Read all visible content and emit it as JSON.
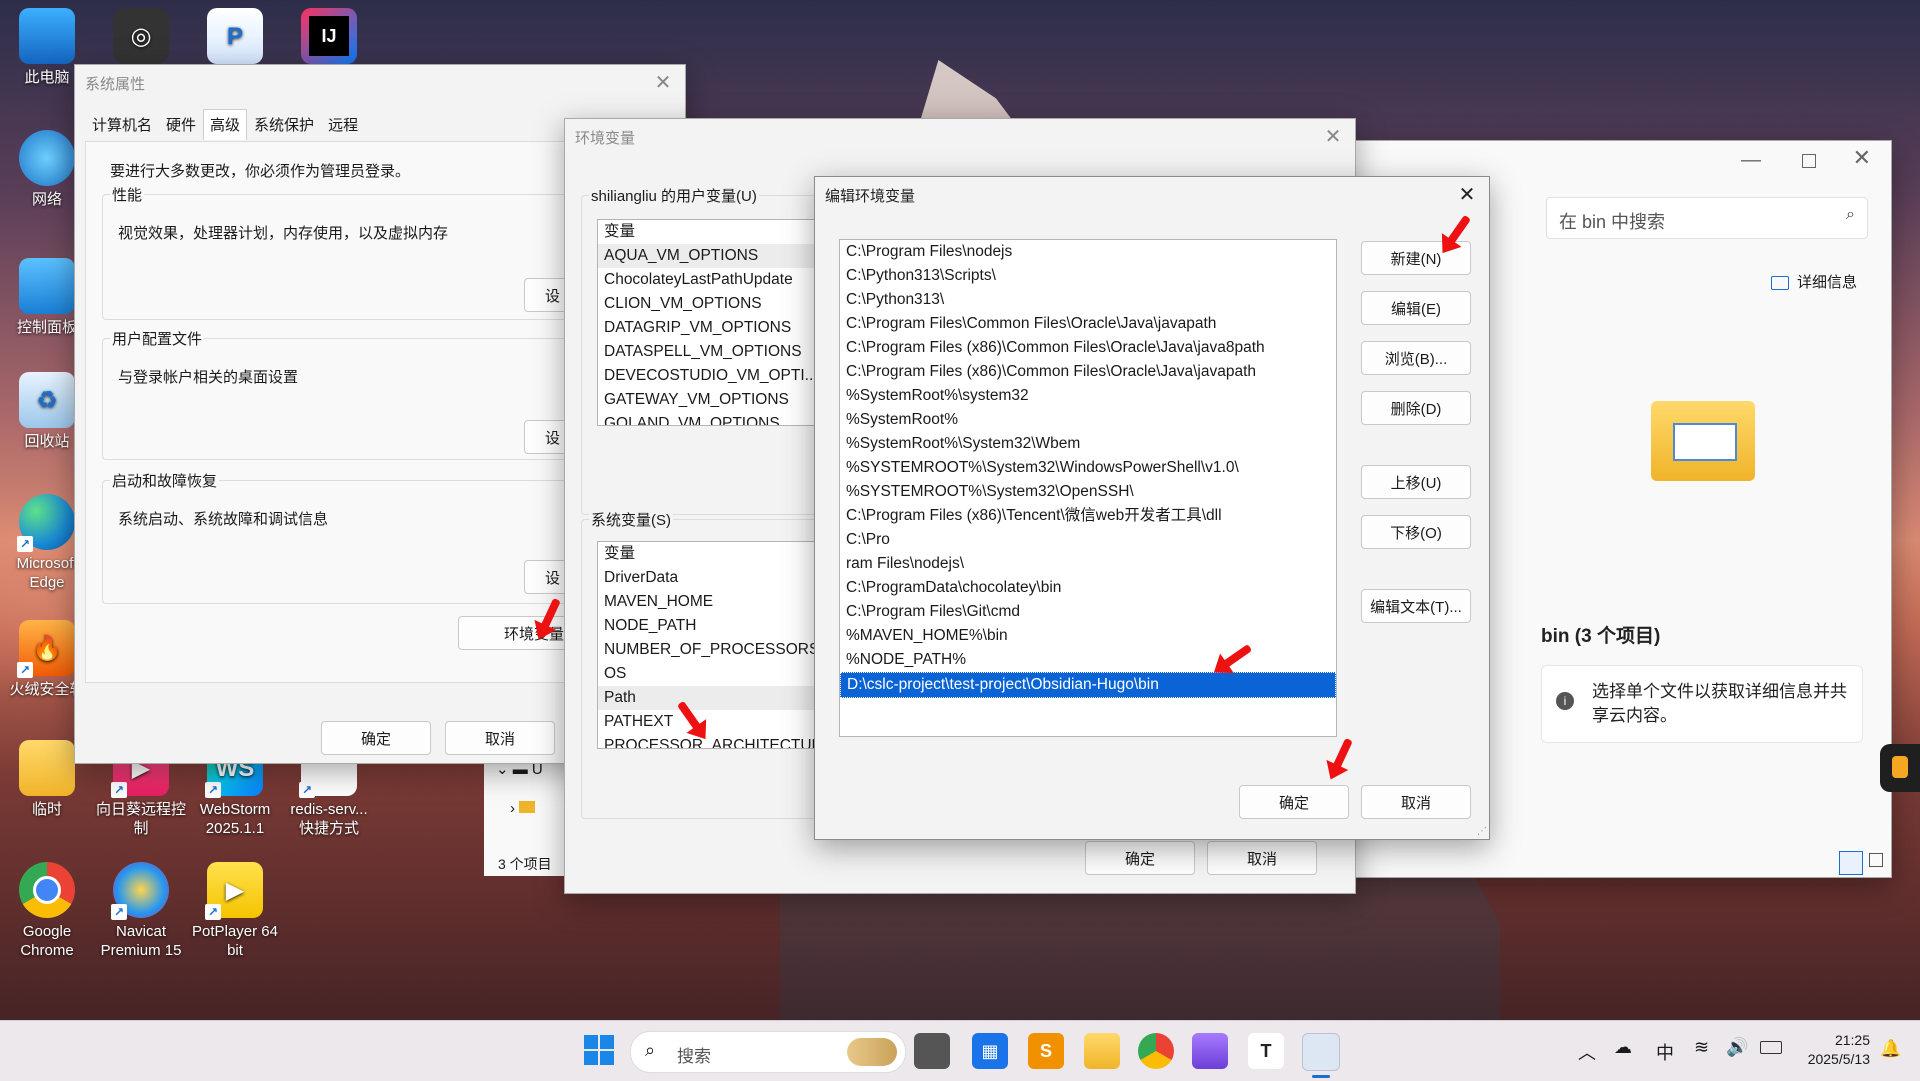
{
  "desktop": {
    "icons": [
      {
        "label": "此电脑"
      },
      {
        "label": "网络"
      },
      {
        "label": "控制面板"
      },
      {
        "label": "回收站"
      },
      {
        "label": "Microsoft Edge"
      },
      {
        "label": "火绒安全软"
      },
      {
        "label": "临时"
      },
      {
        "label": "向日葵远程控制"
      },
      {
        "label": "WebStorm 2025.1.1"
      },
      {
        "label": "redis-serv... 快捷方式"
      },
      {
        "label": "Google Chrome"
      },
      {
        "label": "Navicat Premium 15"
      },
      {
        "label": "PotPlayer 64 bit"
      }
    ]
  },
  "sysprops": {
    "title": "系统属性",
    "tabs": [
      "计算机名",
      "硬件",
      "高级",
      "系统保护",
      "远程"
    ],
    "notice": "要进行大多数更改，你必须作为管理员登录。",
    "perf_label": "性能",
    "perf_desc": "视觉效果，处理器计划，内存使用，以及虚拟内存",
    "profile_label": "用户配置文件",
    "profile_desc": "与登录帐户相关的桌面设置",
    "startup_label": "启动和故障恢复",
    "startup_desc": "系统启动、系统故障和调试信息",
    "settings_btn": "设",
    "env_btn": "环境变量",
    "ok": "确定",
    "cancel": "取消"
  },
  "envvars": {
    "title": "环境变量",
    "user_label": "shiliangliu 的用户变量(U)",
    "user_header": "变量",
    "user_vars": [
      "AQUA_VM_OPTIONS",
      "ChocolateyLastPathUpdate",
      "CLION_VM_OPTIONS",
      "DATAGRIP_VM_OPTIONS",
      "DATASPELL_VM_OPTIONS",
      "DEVECOSTUDIO_VM_OPTI...",
      "GATEWAY_VM_OPTIONS",
      "GOLAND_VM_OPTIONS"
    ],
    "sys_label": "系统变量(S)",
    "sys_header": "变量",
    "sys_vars": [
      "DriverData",
      "MAVEN_HOME",
      "NODE_PATH",
      "NUMBER_OF_PROCESSORS",
      "OS",
      "Path",
      "PATHEXT",
      "PROCESSOR_ARCHITECTURE"
    ],
    "ok": "确定",
    "cancel": "取消"
  },
  "editenv": {
    "title": "编辑环境变量",
    "paths": [
      "C:\\Program Files\\nodejs",
      "C:\\Python313\\Scripts\\",
      "C:\\Python313\\",
      "C:\\Program Files\\Common Files\\Oracle\\Java\\javapath",
      "C:\\Program Files (x86)\\Common Files\\Oracle\\Java\\java8path",
      "C:\\Program Files (x86)\\Common Files\\Oracle\\Java\\javapath",
      "%SystemRoot%\\system32",
      "%SystemRoot%",
      "%SystemRoot%\\System32\\Wbem",
      "%SYSTEMROOT%\\System32\\WindowsPowerShell\\v1.0\\",
      "%SYSTEMROOT%\\System32\\OpenSSH\\",
      "C:\\Program Files (x86)\\Tencent\\微信web开发者工具\\dll",
      "C:\\Pro",
      "ram Files\\nodejs\\",
      "C:\\ProgramData\\chocolatey\\bin",
      "C:\\Program Files\\Git\\cmd",
      "%MAVEN_HOME%\\bin",
      "%NODE_PATH%",
      "D:\\cslc-project\\test-project\\Obsidian-Hugo\\bin"
    ],
    "buttons": {
      "new": "新建(N)",
      "edit": "编辑(E)",
      "browse": "浏览(B)...",
      "delete": "删除(D)",
      "up": "上移(U)",
      "down": "下移(O)",
      "edit_text": "编辑文本(T)..."
    },
    "ok": "确定",
    "cancel": "取消"
  },
  "explorer": {
    "search_placeholder": "在 bin 中搜索",
    "details": "详细信息",
    "folder_title": "bin (3 个项目)",
    "info_text": "选择单个文件以获取详细信息并共享云内容。",
    "status": "3 个项目",
    "tree_item": "U"
  },
  "taskbar": {
    "search": "搜索",
    "ime": "中",
    "time": "21:25",
    "date": "2025/5/13"
  },
  "colors": {
    "selection": "#0a64d6",
    "accent_red": "#e11111"
  }
}
